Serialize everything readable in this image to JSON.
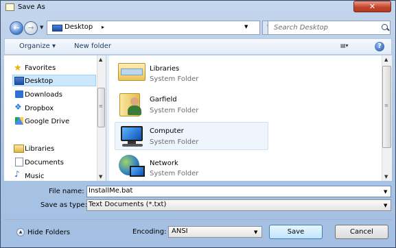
{
  "window": {
    "title": "Save As",
    "close_glyph": "✕"
  },
  "nav": {
    "back_glyph": "←",
    "forward_glyph": "→",
    "address_location": "Desktop",
    "address_sep": "▸",
    "refresh_glyph": "↻",
    "search_placeholder": "Search Desktop"
  },
  "toolbar": {
    "organize": "Organize ▾",
    "new_folder": "New folder",
    "views_glyph": "▤▾",
    "help_glyph": "?"
  },
  "sidebar": {
    "items": [
      {
        "label": "Favorites",
        "icon": "star-icon"
      },
      {
        "label": "Desktop",
        "icon": "desktop-icon",
        "selected": true
      },
      {
        "label": "Downloads",
        "icon": "downloads-icon"
      },
      {
        "label": "Dropbox",
        "icon": "dropbox-icon"
      },
      {
        "label": "Google Drive",
        "icon": "google-drive-icon"
      },
      {
        "label": "Libraries",
        "icon": "libraries-icon"
      },
      {
        "label": "Documents",
        "icon": "documents-icon"
      },
      {
        "label": "Music",
        "icon": "music-icon"
      }
    ],
    "scroll_up": "▲",
    "scroll_down": "▼",
    "thumb_grip": "≡"
  },
  "files": [
    {
      "name": "Libraries",
      "type": "System Folder",
      "icon": "libraries-folder-icon"
    },
    {
      "name": "Garfield",
      "type": "System Folder",
      "icon": "user-folder-icon"
    },
    {
      "name": "Computer",
      "type": "System Folder",
      "icon": "computer-icon",
      "hovered": true
    },
    {
      "name": "Network",
      "type": "System Folder",
      "icon": "network-icon"
    }
  ],
  "bottom": {
    "file_name_label": "File name:",
    "file_name_value": "InstallMe.bat",
    "save_type_label": "Save as type:",
    "save_type_value": "Text Documents (*.txt)",
    "hide_folders": "Hide Folders",
    "hide_glyph": "▲",
    "encoding_label": "Encoding:",
    "encoding_value": "ANSI",
    "save": "Save",
    "cancel": "Cancel",
    "dropdown_glyph": "▼"
  }
}
